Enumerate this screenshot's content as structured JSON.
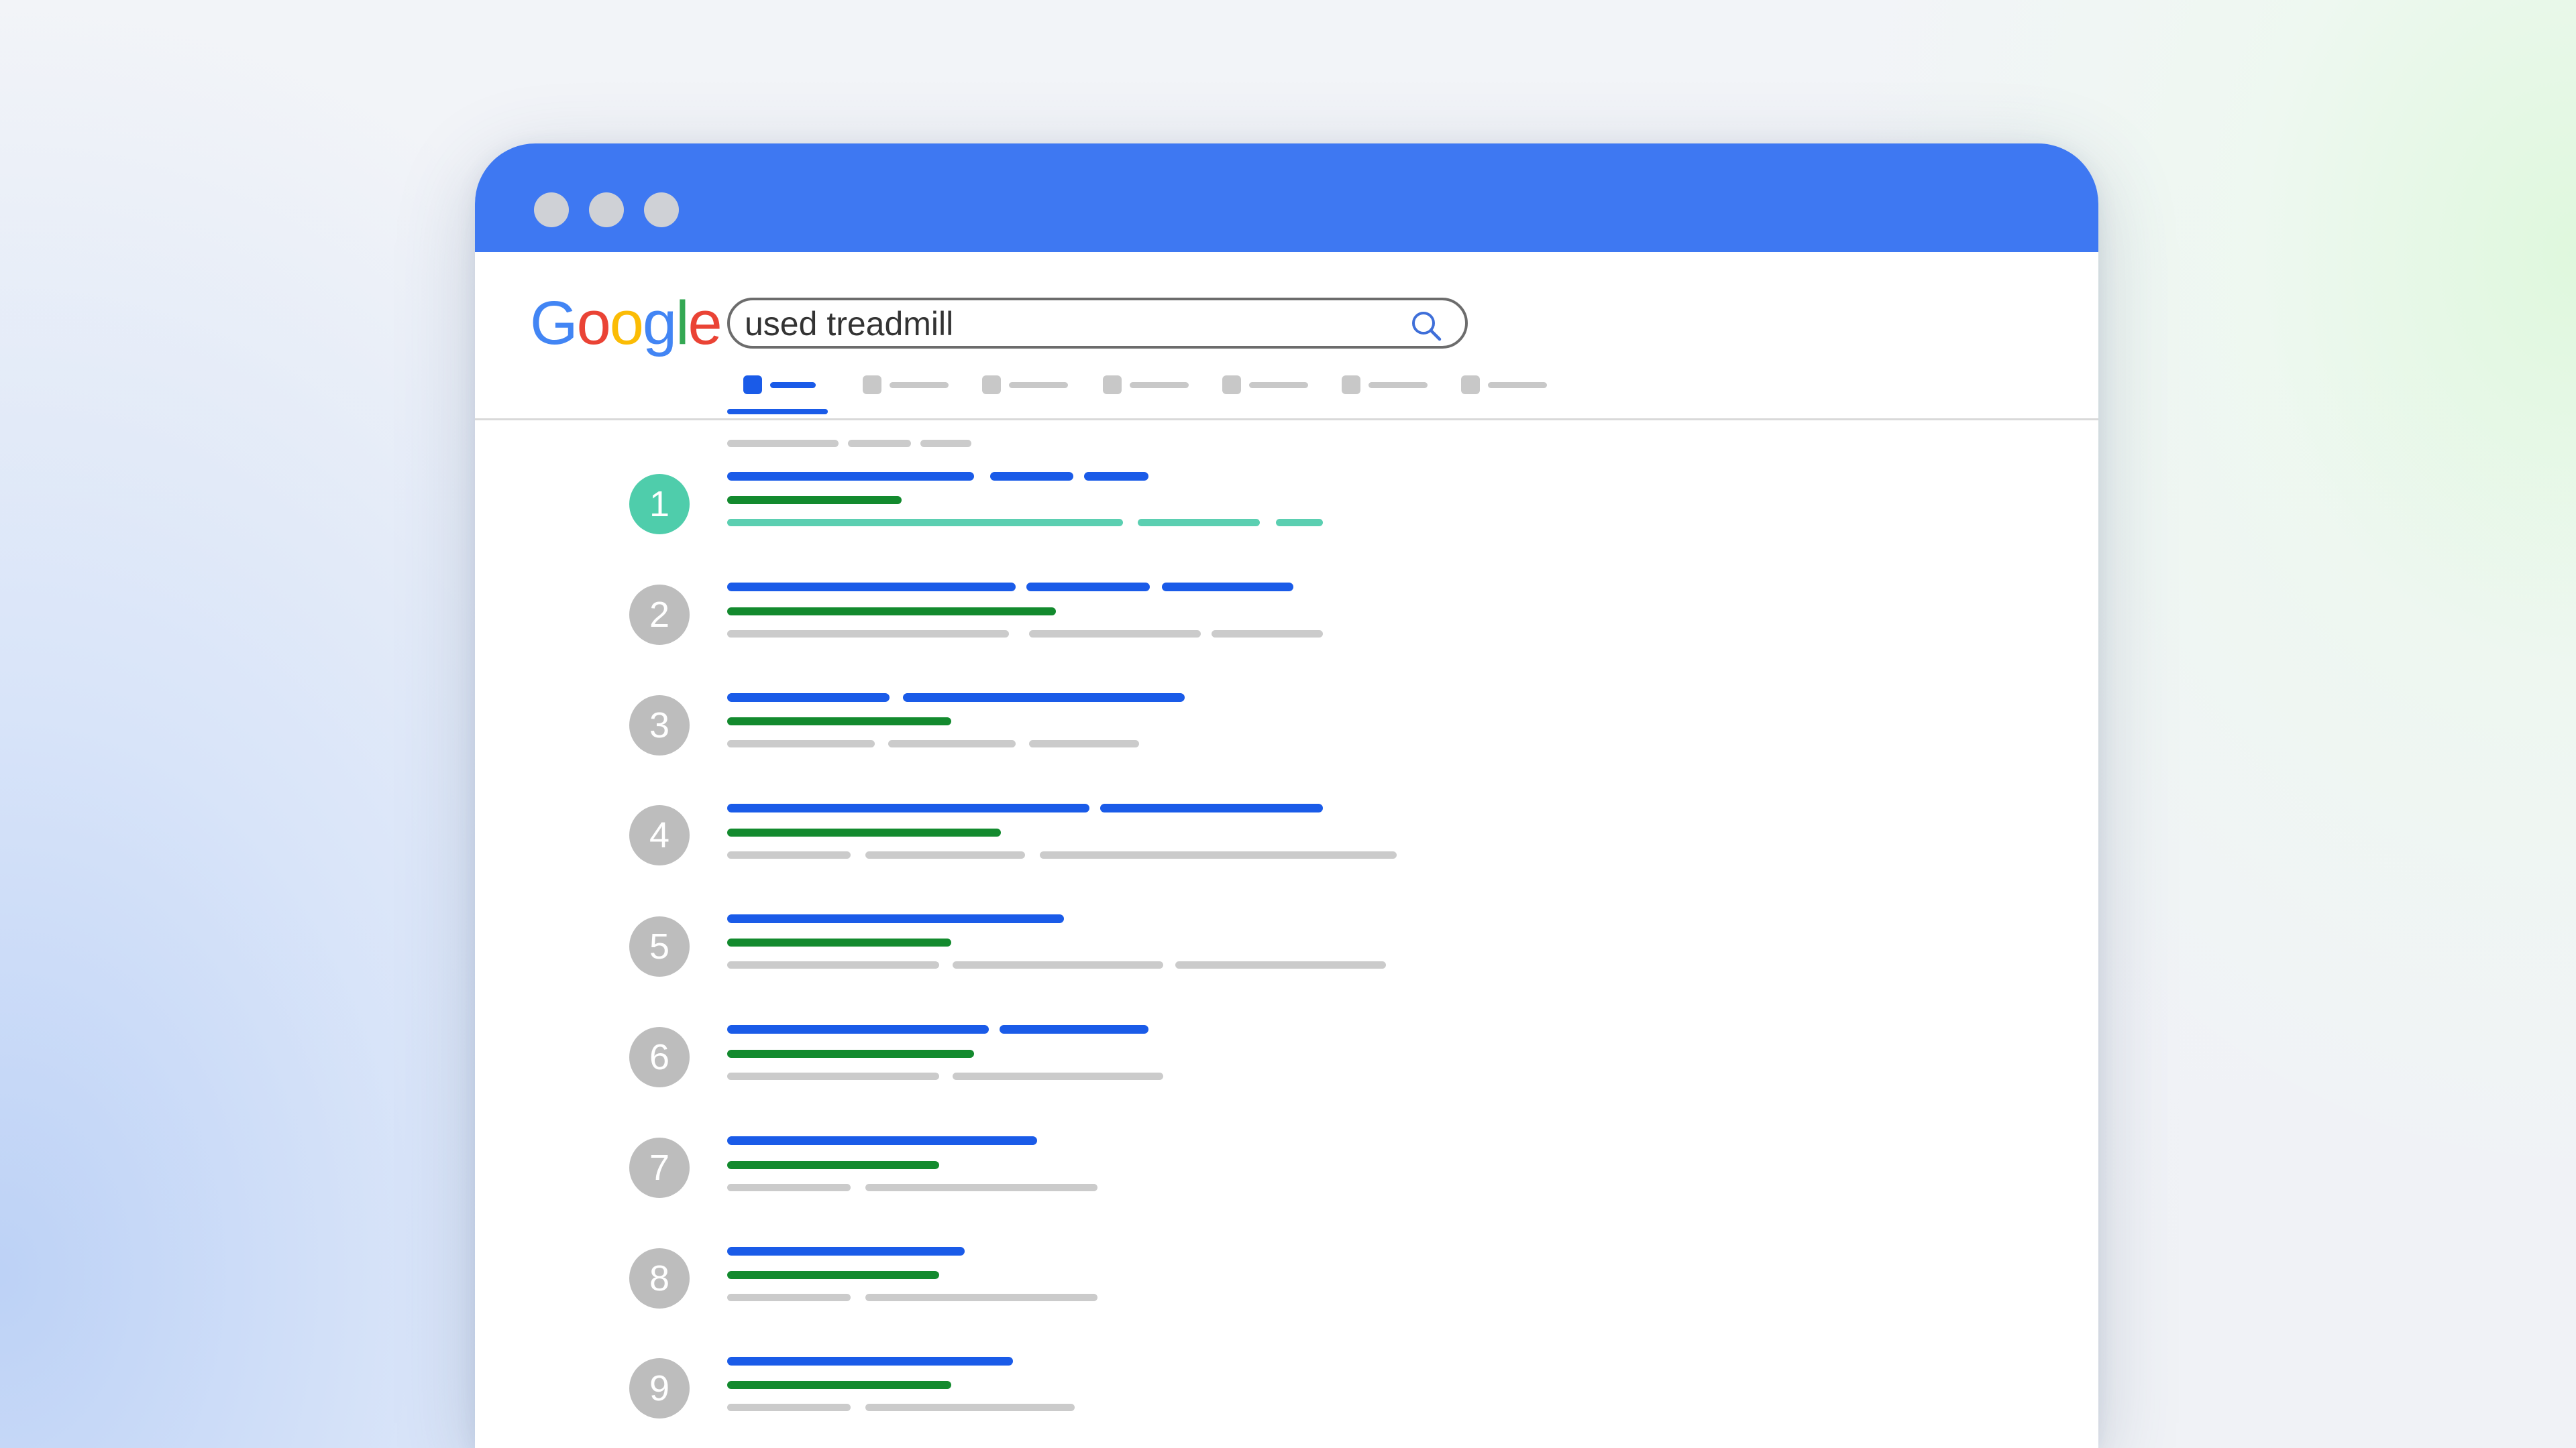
{
  "logo": {
    "text": "Google",
    "letters": [
      {
        "char": "G",
        "color": "#4285F4"
      },
      {
        "char": "o",
        "color": "#EA4335"
      },
      {
        "char": "o",
        "color": "#FBBC05"
      },
      {
        "char": "g",
        "color": "#4285F4"
      },
      {
        "char": "l",
        "color": "#34A853"
      },
      {
        "char": "e",
        "color": "#EA4335"
      }
    ]
  },
  "search": {
    "query": "used treadmill",
    "icon": "search-icon"
  },
  "tabs": {
    "count": 7,
    "active_index": 0
  },
  "results": [
    {
      "rank": "1",
      "highlighted": true
    },
    {
      "rank": "2",
      "highlighted": false
    },
    {
      "rank": "3",
      "highlighted": false
    },
    {
      "rank": "4",
      "highlighted": false
    },
    {
      "rank": "5",
      "highlighted": false
    },
    {
      "rank": "6",
      "highlighted": false
    },
    {
      "rank": "7",
      "highlighted": false
    },
    {
      "rank": "8",
      "highlighted": false
    },
    {
      "rank": "9",
      "highlighted": false
    }
  ],
  "colors": {
    "titlebar": "#3e78f2",
    "link_blue": "#1a5be8",
    "url_green": "#138a2e",
    "snippet_gray": "#cbcbcb",
    "highlight_teal": "#4fcdab",
    "rank_gray": "#bdbdbd"
  }
}
